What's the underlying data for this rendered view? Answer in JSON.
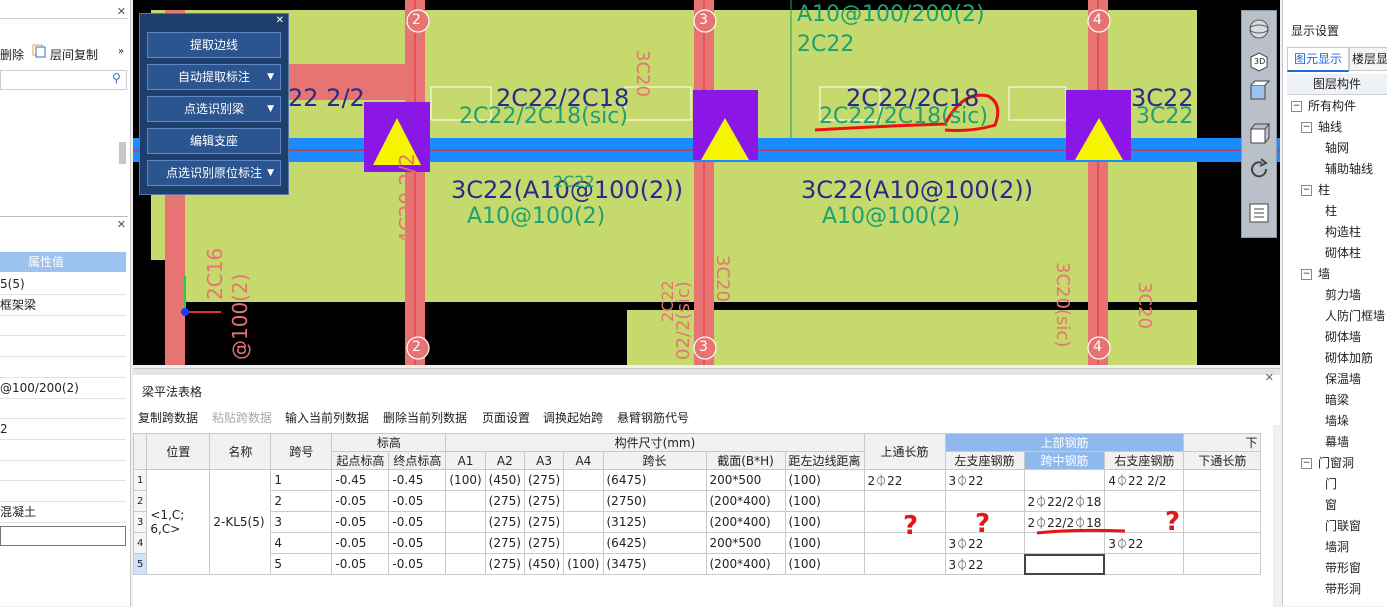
{
  "left_panel": {
    "toolbar_delete": "删除",
    "toolbar_copy_floor": "层间复制",
    "prop_header": "属性值",
    "props": [
      "5(5)",
      "框架梁",
      "",
      "",
      "",
      "@100/200(2)",
      "",
      "2",
      "",
      "",
      "",
      "混凝土"
    ]
  },
  "float_panel": {
    "buttons": [
      "提取边线",
      "自动提取标注",
      "点选识别梁",
      "编辑支座",
      "点选识别原位标注"
    ]
  },
  "canvas": {
    "axis_labels": [
      "2",
      "3",
      "4",
      "2",
      "3",
      "4"
    ],
    "texts": {
      "t1": "22 2/2",
      "t2": "2C22/2C18",
      "t3": "2C22/2C18(sic)",
      "t4": "2C22/2C18",
      "t5": "2C22/2C18(sic)",
      "t6": "3C22",
      "t7": "3C22",
      "t8": "3C22(A10@100(2))",
      "t9": "A10@100(2)",
      "t10": "3C22(A10@100(2))",
      "t11": "A10@100(2)",
      "t12": "A10@100/200(2)",
      "t13": "2C22",
      "t14": "3C20",
      "t15": "2C22",
      "t16": "4C20 2/2",
      "t17": "3C20",
      "t18": "3C20(sic)",
      "t19": "3C20",
      "t20": "2C16",
      "t21": "@100(2)",
      "t22": "2C22",
      "t23": "02/2(sic)"
    },
    "view_buttons": [
      "3D"
    ]
  },
  "bottom_pane": {
    "title": "梁平法表格",
    "toolbar": [
      "复制跨数据",
      "粘贴跨数据",
      "输入当前列数据",
      "删除当前列数据",
      "页面设置",
      "调换起始跨",
      "悬臂钢筋代号"
    ],
    "header_groups": {
      "elevation": "标高",
      "size": "构件尺寸(mm)",
      "top_rebar": "上部钢筋",
      "next": "下"
    },
    "columns": {
      "position": "位置",
      "name": "名称",
      "span_no": "跨号",
      "start_elev": "起点标高",
      "end_elev": "终点标高",
      "a1": "A1",
      "a2": "A2",
      "a3": "A3",
      "a4": "A4",
      "span_len": "跨长",
      "section": "截面(B*H)",
      "left_dist": "距左边线距离",
      "top_through": "上通长筋",
      "left_seat": "左支座钢筋",
      "mid_span": "跨中钢筋",
      "right_seat": "右支座钢筋",
      "bottom_through": "下通长筋"
    },
    "row_numbers": [
      "1",
      "2",
      "3",
      "4",
      "5"
    ],
    "position_value": "<1,C;\n6,C>",
    "name_value": "2-KL5(5)",
    "rows": [
      {
        "span": "1",
        "start": "-0.45",
        "end": "-0.45",
        "a1": "(100)",
        "a2": "(450)",
        "a3": "(275)",
        "a4": "",
        "len": "(6475)",
        "sec": "200*500",
        "dist": "(100)",
        "top": "2⏀22",
        "left": "3⏀22",
        "mid": "",
        "right": "4⏀22 2/2",
        "bot": ""
      },
      {
        "span": "2",
        "start": "-0.05",
        "end": "-0.05",
        "a1": "",
        "a2": "(275)",
        "a3": "(275)",
        "a4": "",
        "len": "(2750)",
        "sec": "(200*400)",
        "dist": "(100)",
        "top": "",
        "left": "",
        "mid": "2⏀22/2⏀18",
        "right": "",
        "bot": ""
      },
      {
        "span": "3",
        "start": "-0.05",
        "end": "-0.05",
        "a1": "",
        "a2": "(275)",
        "a3": "(275)",
        "a4": "",
        "len": "(3125)",
        "sec": "(200*400)",
        "dist": "(100)",
        "top": "",
        "left": "",
        "mid": "2⏀22/2⏀18",
        "right": "",
        "bot": ""
      },
      {
        "span": "4",
        "start": "-0.05",
        "end": "-0.05",
        "a1": "",
        "a2": "(275)",
        "a3": "(275)",
        "a4": "",
        "len": "(6425)",
        "sec": "200*500",
        "dist": "(100)",
        "top": "",
        "left": "3⏀22",
        "mid": "",
        "right": "3⏀22",
        "bot": ""
      },
      {
        "span": "5",
        "start": "-0.05",
        "end": "-0.05",
        "a1": "",
        "a2": "(275)",
        "a3": "(450)",
        "a4": "(100)",
        "len": "(3475)",
        "sec": "(200*400)",
        "dist": "(100)",
        "top": "",
        "left": "3⏀22",
        "mid": "",
        "right": "",
        "bot": ""
      }
    ],
    "annotation_marks": [
      "?",
      "?",
      "?"
    ]
  },
  "right_panel": {
    "title": "显示设置",
    "tabs": [
      "图元显示",
      "楼层显"
    ],
    "tree_header": "图层构件",
    "tree": [
      {
        "label": "所有构件",
        "level": 0,
        "toggle": "−"
      },
      {
        "label": "轴线",
        "level": 1,
        "toggle": "−"
      },
      {
        "label": "轴网",
        "level": 2
      },
      {
        "label": "辅助轴线",
        "level": 2
      },
      {
        "label": "柱",
        "level": 1,
        "toggle": "−"
      },
      {
        "label": "柱",
        "level": 2
      },
      {
        "label": "构造柱",
        "level": 2
      },
      {
        "label": "砌体柱",
        "level": 2
      },
      {
        "label": "墙",
        "level": 1,
        "toggle": "−"
      },
      {
        "label": "剪力墙",
        "level": 2
      },
      {
        "label": "人防门框墙",
        "level": 2
      },
      {
        "label": "砌体墙",
        "level": 2
      },
      {
        "label": "砌体加筋",
        "level": 2
      },
      {
        "label": "保温墙",
        "level": 2
      },
      {
        "label": "暗梁",
        "level": 2
      },
      {
        "label": "墙垛",
        "level": 2
      },
      {
        "label": "幕墙",
        "level": 2
      },
      {
        "label": "门窗洞",
        "level": 1,
        "toggle": "−"
      },
      {
        "label": "门",
        "level": 2
      },
      {
        "label": "窗",
        "level": 2
      },
      {
        "label": "门联窗",
        "level": 2
      },
      {
        "label": "墙洞",
        "level": 2
      },
      {
        "label": "带形窗",
        "level": 2
      },
      {
        "label": "带形洞",
        "level": 2
      }
    ]
  },
  "colors": {
    "slab": "#c6d96c",
    "column": "#e77373",
    "beam": "#1a8cff",
    "support": "#8a17e6",
    "triangle": "#f5f500",
    "axis_red": "#e03030",
    "cad_text": "#2a2a8a",
    "cad_green": "#1fa070"
  }
}
